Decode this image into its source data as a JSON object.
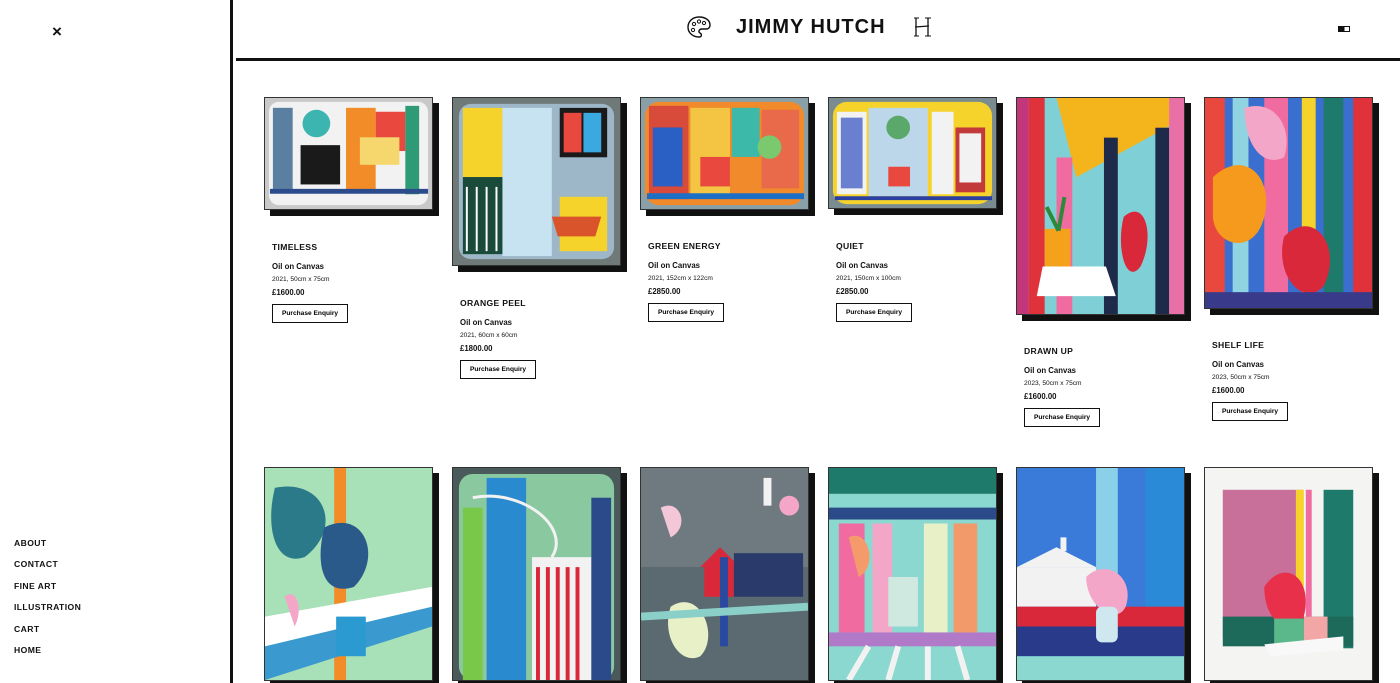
{
  "header": {
    "brand": "JIMMY HUTCH"
  },
  "sidebar": {
    "close_label": "×",
    "nav": [
      "ABOUT",
      "CONTACT",
      "FINE ART",
      "ILLUSTRATION",
      "CART",
      "HOME"
    ]
  },
  "products": [
    {
      "title": "TIMELESS",
      "medium": "Oil on Canvas",
      "details": "2021, 50cm x 75cm",
      "price": "£1600.00",
      "button": "Purchase Enquiry"
    },
    {
      "title": "ORANGE PEEL",
      "medium": "Oil on Canvas",
      "details": "2021, 60cm x 60cm",
      "price": "£1800.00",
      "button": "Purchase Enquiry"
    },
    {
      "title": "GREEN ENERGY",
      "medium": "Oil on Canvas",
      "details": "2021, 152cm x 122cm",
      "price": "£2850.00",
      "button": "Purchase Enquiry"
    },
    {
      "title": "QUIET",
      "medium": "Oil on Canvas",
      "details": "2021, 150cm x 100cm",
      "price": "£2850.00",
      "button": "Purchase Enquiry"
    },
    {
      "title": "DRAWN UP",
      "medium": "Oil on Canvas",
      "details": "2023, 50cm x 75cm",
      "price": "£1600.00",
      "button": "Purchase Enquiry"
    },
    {
      "title": "SHELF LIFE",
      "medium": "Oil on Canvas",
      "details": "2023, 50cm x 75cm",
      "price": "£1600.00",
      "button": "Purchase Enquiry"
    }
  ],
  "colors": {
    "accent": "#111111",
    "background": "#ffffff"
  }
}
